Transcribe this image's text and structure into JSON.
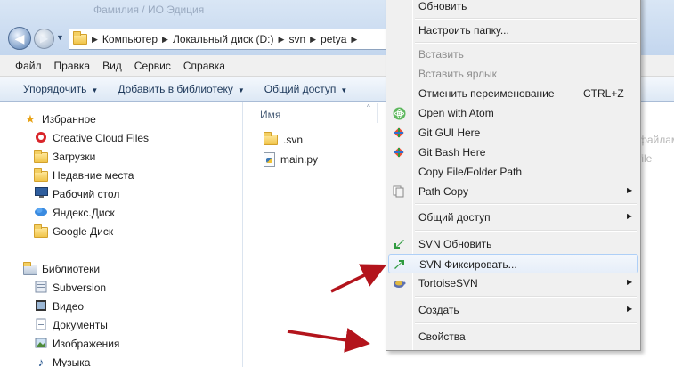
{
  "window": {
    "faded_title": "Фамилия / ИО Эдиция"
  },
  "address": {
    "crumbs": [
      "Компьютер",
      "Локальный диск (D:)",
      "svn",
      "petya"
    ],
    "sep": "▶",
    "back": "◀",
    "forward": "▶",
    "history": "▼"
  },
  "menubar": {
    "items": [
      "Файл",
      "Правка",
      "Вид",
      "Сервис",
      "Справка"
    ]
  },
  "toolbar": {
    "items": [
      "Упорядочить",
      "Добавить в библиотеку",
      "Общий доступ"
    ],
    "arrow": "▼"
  },
  "nav": {
    "favorites": {
      "label": "Избранное",
      "items": [
        "Creative Cloud Files",
        "Загрузки",
        "Недавние места",
        "Рабочий стол",
        "Яндекс.Диск",
        "Google Диск"
      ]
    },
    "libraries": {
      "label": "Библиотеки",
      "items": [
        "Subversion",
        "Видео",
        "Документы",
        "Изображения",
        "Музыка"
      ]
    }
  },
  "content": {
    "column_name": "Имя",
    "sort_indicator": "^",
    "files": [
      ".svn",
      "main.py"
    ],
    "bg_fragments": [
      "файлам",
      "file"
    ]
  },
  "context_menu": {
    "items": [
      {
        "label": "Обновить",
        "icon": "none"
      },
      {
        "label": "Настроить папку...",
        "icon": "none"
      },
      {
        "label": "Вставить",
        "icon": "none",
        "disabled": true
      },
      {
        "label": "Вставить ярлык",
        "icon": "none",
        "disabled": true
      },
      {
        "label": "Отменить переименование",
        "shortcut": "CTRL+Z",
        "icon": "none"
      },
      {
        "label": "Open with Atom",
        "icon": "atom-icon"
      },
      {
        "label": "Git GUI Here",
        "icon": "git-icon"
      },
      {
        "label": "Git Bash Here",
        "icon": "git-icon"
      },
      {
        "label": "Copy File/Folder Path",
        "icon": "none"
      },
      {
        "label": "Path Copy",
        "icon": "path-copy-icon",
        "submenu": true
      },
      {
        "label": "Общий доступ",
        "icon": "none",
        "submenu": true
      },
      {
        "label": "SVN Обновить",
        "icon": "svn-update-icon"
      },
      {
        "label": "SVN Фиксировать...",
        "icon": "svn-commit-icon",
        "highlighted": true
      },
      {
        "label": "TortoiseSVN",
        "icon": "tortoise-icon",
        "submenu": true
      },
      {
        "label": "Создать",
        "icon": "none",
        "submenu": true
      },
      {
        "label": "Свойства",
        "icon": "none"
      }
    ],
    "submenu_arrow": "▶"
  },
  "colors": {
    "menu_bg": "#f0f0f0",
    "highlight_border": "#aecff7",
    "annotation_arrow": "#b3141c",
    "address_bg": "#c3d6ee"
  }
}
